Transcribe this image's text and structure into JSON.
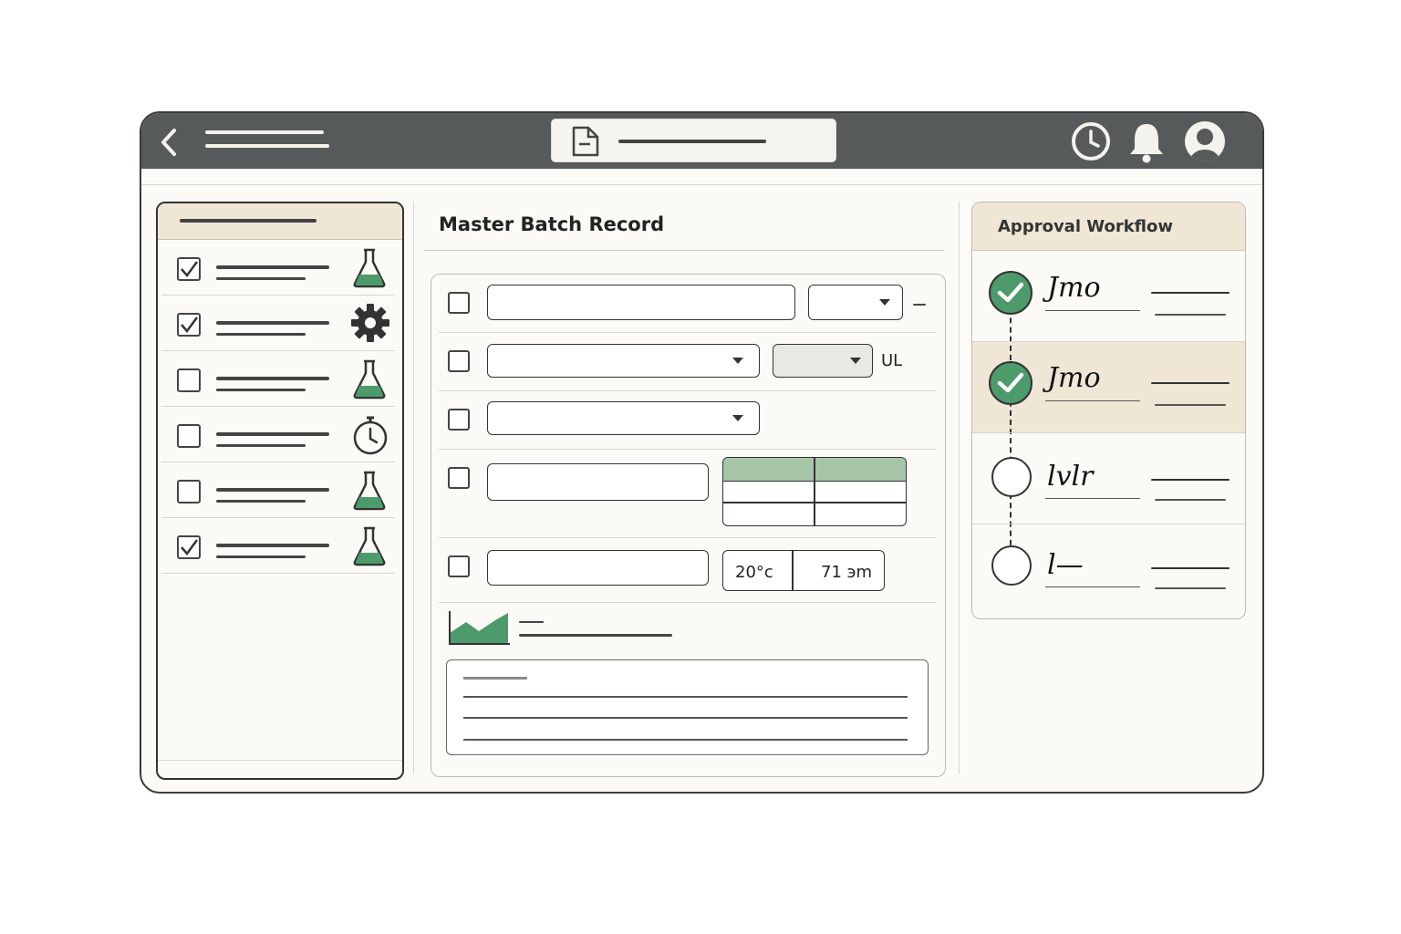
{
  "main": {
    "title": "Master Batch Record",
    "unit_label": "UL",
    "reading_temp": "20°c",
    "reading_time": "71 эm"
  },
  "approval": {
    "title": "Approval Workflow",
    "steps": [
      {
        "signature": "Jmo",
        "status": "approved"
      },
      {
        "signature": "Jmo",
        "status": "approved"
      },
      {
        "signature": "lvlr",
        "status": "pending"
      },
      {
        "signature": "l—",
        "status": "pending"
      }
    ]
  },
  "colors": {
    "topbar": "#575a5a",
    "accent_green": "#4d9a6b",
    "panel_header": "#efe6d6",
    "table_header": "#a7c6a9"
  },
  "icons": [
    "back-icon",
    "document-icon",
    "history-icon",
    "bell-icon",
    "user-icon",
    "flask-icon",
    "gear-icon",
    "timer-icon",
    "chart-icon",
    "check-icon"
  ]
}
